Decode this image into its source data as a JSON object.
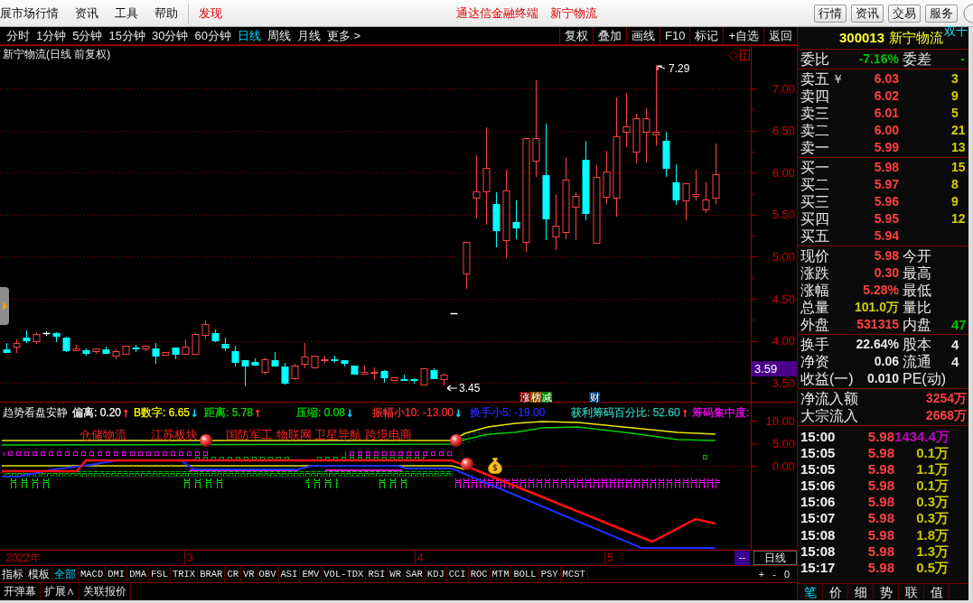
{
  "menu_bar": {
    "items": [
      {
        "label": "展市场行情",
        "kind": "plain"
      },
      {
        "label": "资讯",
        "kind": "plain"
      },
      {
        "label": "工具",
        "kind": "plain"
      },
      {
        "label": "帮助",
        "kind": "plain"
      },
      {
        "label": "发现",
        "kind": "accent"
      }
    ],
    "title_parts": [
      "通达信金融终端",
      "新宁物流"
    ],
    "buttons": [
      "行情",
      "资讯",
      "交易",
      "服务"
    ]
  },
  "period_bar": {
    "periods": [
      {
        "label": "分时",
        "selected": false
      },
      {
        "label": "1分钟",
        "selected": false
      },
      {
        "label": "5分钟",
        "selected": false
      },
      {
        "label": "15分钟",
        "selected": false
      },
      {
        "label": "30分钟",
        "selected": false
      },
      {
        "label": "60分钟",
        "selected": false
      },
      {
        "label": "日线",
        "selected": true
      },
      {
        "label": "周线",
        "selected": false
      },
      {
        "label": "月线",
        "selected": false
      },
      {
        "label": "更多 >",
        "selected": false
      }
    ],
    "actions": [
      "复权",
      "叠加",
      "画线",
      "F10",
      "标记",
      "+自选",
      "返回"
    ]
  },
  "main_chart": {
    "title": "新宁物流(日线 前复权)",
    "price_axis": [
      "7.00",
      "6.50",
      "6.00",
      "5.50",
      "5.00",
      "4.50",
      "4.00",
      "3.50"
    ],
    "current_price": "3.59",
    "high_label": "7.29",
    "low_label": "3.45",
    "event_tags": [
      {
        "label": "涨",
        "color": "#800000"
      },
      {
        "label": "榜",
        "color": "#8a5000"
      },
      {
        "label": "减",
        "color": "#008000"
      },
      {
        "label": "财",
        "color": "#003a70"
      }
    ]
  },
  "indicator": {
    "title": "趋势看盘安静",
    "readings": [
      {
        "label": "偏离: 0.20",
        "color": "#ffffff",
        "arrow": {
          "text": "↑",
          "color": "#ff3030"
        }
      },
      {
        "label": "B数字: 6.65",
        "color": "#ffff00",
        "arrow": {
          "text": "↓",
          "color": "#00e0ff"
        }
      },
      {
        "label": "距离: 5.78",
        "color": "#00e000",
        "arrow": {
          "text": "↑",
          "color": "#ff3030"
        }
      },
      {
        "label": "压缩: 0.08",
        "color": "#00e000",
        "arrow": {
          "text": "↓",
          "color": "#00e0ff"
        }
      },
      {
        "label": "振幅小10: -13.00",
        "color": "#ff3030",
        "arrow": {
          "text": "↓",
          "color": "#00e0ff"
        }
      },
      {
        "label": "换手小5: -19.00",
        "color": "#2a2aff"
      },
      {
        "label": "获利筹码百分比: 52.60",
        "color": "#30c8b8",
        "arrow": {
          "text": "↑",
          "color": "#ff3030"
        }
      },
      {
        "label": "筹码集中度:",
        "color": "#ff00ff"
      }
    ],
    "sector_labels": [
      "仓储物流",
      "江苏板块",
      "国防军工 物联网 卫星导航 跨境电商"
    ],
    "axis": [
      "10.00",
      "5.00",
      "0.00"
    ]
  },
  "date_axis": {
    "labels": [
      "2022年",
      "3",
      "4",
      "5"
    ],
    "scroll_button": "--",
    "period": "日线"
  },
  "indicator_tabs": [
    {
      "label": "指标",
      "selected": false
    },
    {
      "label": "模板",
      "selected": false
    },
    {
      "label": "全部",
      "selected": true
    },
    {
      "label": "MACD",
      "selected": false
    },
    {
      "label": "DMI",
      "selected": false
    },
    {
      "label": "DMA",
      "selected": false
    },
    {
      "label": "FSL",
      "selected": false
    },
    {
      "label": "TRIX",
      "selected": false
    },
    {
      "label": "BRAR",
      "selected": false
    },
    {
      "label": "CR",
      "selected": false
    },
    {
      "label": "VR",
      "selected": false
    },
    {
      "label": "OBV",
      "selected": false
    },
    {
      "label": "ASI",
      "selected": false
    },
    {
      "label": "EMV",
      "selected": false
    },
    {
      "label": "VOL-TDX",
      "selected": false
    },
    {
      "label": "RSI",
      "selected": false
    },
    {
      "label": "WR",
      "selected": false
    },
    {
      "label": "SAR",
      "selected": false
    },
    {
      "label": "KDJ",
      "selected": false
    },
    {
      "label": "CCI",
      "selected": false
    },
    {
      "label": "ROC",
      "selected": false
    },
    {
      "label": "MTM",
      "selected": false
    },
    {
      "label": "BOLL",
      "selected": false
    },
    {
      "label": "PSY",
      "selected": false
    },
    {
      "label": "MCST",
      "selected": false
    }
  ],
  "zoom_buttons": [
    "+",
    "-",
    "0"
  ],
  "bottom_bar": [
    "开弹幕",
    "扩展∧",
    "关联报价"
  ],
  "quote_panel": {
    "code": "300013",
    "name": "新宁物流",
    "badge": "双十",
    "ratio": {
      "label": "委比",
      "value": "-7.16%",
      "right": {
        "label": "委差",
        "value": "-"
      }
    },
    "asks": [
      {
        "label": "卖五",
        "tag": "￥",
        "price": "6.03",
        "volume": "3"
      },
      {
        "label": "卖四",
        "price": "6.02",
        "volume": "9"
      },
      {
        "label": "卖三",
        "price": "6.01",
        "volume": "5"
      },
      {
        "label": "卖二",
        "price": "6.00",
        "volume": "21"
      },
      {
        "label": "卖一",
        "price": "5.99",
        "volume": "13"
      }
    ],
    "bids": [
      {
        "label": "买一",
        "price": "5.98",
        "volume": "15"
      },
      {
        "label": "买二",
        "price": "5.97",
        "volume": "8"
      },
      {
        "label": "买三",
        "price": "5.96",
        "volume": "9"
      },
      {
        "label": "买四",
        "price": "5.95",
        "volume": "12"
      },
      {
        "label": "买五",
        "price": "5.94"
      }
    ],
    "stats": [
      {
        "label": "现价",
        "value": "5.98",
        "color": "#ff4040",
        "right": {
          "label": "今开"
        }
      },
      {
        "label": "涨跌",
        "value": "0.30",
        "color": "#ff4040",
        "right": {
          "label": "最高"
        }
      },
      {
        "label": "涨幅",
        "value": "5.28%",
        "color": "#ff4040",
        "right": {
          "label": "最低"
        }
      },
      {
        "label": "总量",
        "value": "101.0万",
        "color": "#d0d000",
        "right": {
          "label": "量比"
        }
      },
      {
        "label": "外盘",
        "value": "531315",
        "color": "#ff4040",
        "right": {
          "label": "内盘",
          "value": "47",
          "color": "#00c000"
        }
      }
    ],
    "fundamentals": [
      {
        "label": "换手",
        "value": "22.64%",
        "right": {
          "label": "股本",
          "value": "4"
        }
      },
      {
        "label": "净资",
        "value": "0.06",
        "right": {
          "label": "流通",
          "value": "4"
        }
      },
      {
        "label": "收益(一)",
        "value": "0.010",
        "right": {
          "label": "PE(动)"
        }
      }
    ],
    "flows": [
      {
        "label": "净流入额",
        "value": "3254万"
      },
      {
        "label": "大宗流入",
        "value": "2668万"
      }
    ],
    "ticks": [
      {
        "time": "15:00",
        "price": "5.98",
        "volume": "1434.4万",
        "color": "#c000c0"
      },
      {
        "time": "15:05",
        "price": "5.98",
        "volume": "0.1万",
        "color": "#c8c800"
      },
      {
        "time": "15:05",
        "price": "5.98",
        "volume": "1.1万",
        "color": "#c8c800"
      },
      {
        "time": "15:06",
        "price": "5.98",
        "volume": "0.1万",
        "color": "#c8c800"
      },
      {
        "time": "15:06",
        "price": "5.98",
        "volume": "0.3万",
        "color": "#c8c800"
      },
      {
        "time": "15:07",
        "price": "5.98",
        "volume": "0.3万",
        "color": "#c8c800"
      },
      {
        "time": "15:08",
        "price": "5.98",
        "volume": "1.8万",
        "color": "#c8c800"
      },
      {
        "time": "15:08",
        "price": "5.98",
        "volume": "1.3万",
        "color": "#c8c800"
      },
      {
        "time": "15:17",
        "price": "5.98",
        "volume": "0.5万",
        "color": "#c8c800"
      }
    ],
    "tabs": [
      {
        "label": "笔",
        "selected": true
      },
      {
        "label": "价",
        "selected": false
      },
      {
        "label": "细",
        "selected": false
      },
      {
        "label": "势",
        "selected": false
      },
      {
        "label": "联",
        "selected": false
      },
      {
        "label": "值",
        "selected": false
      }
    ]
  }
}
